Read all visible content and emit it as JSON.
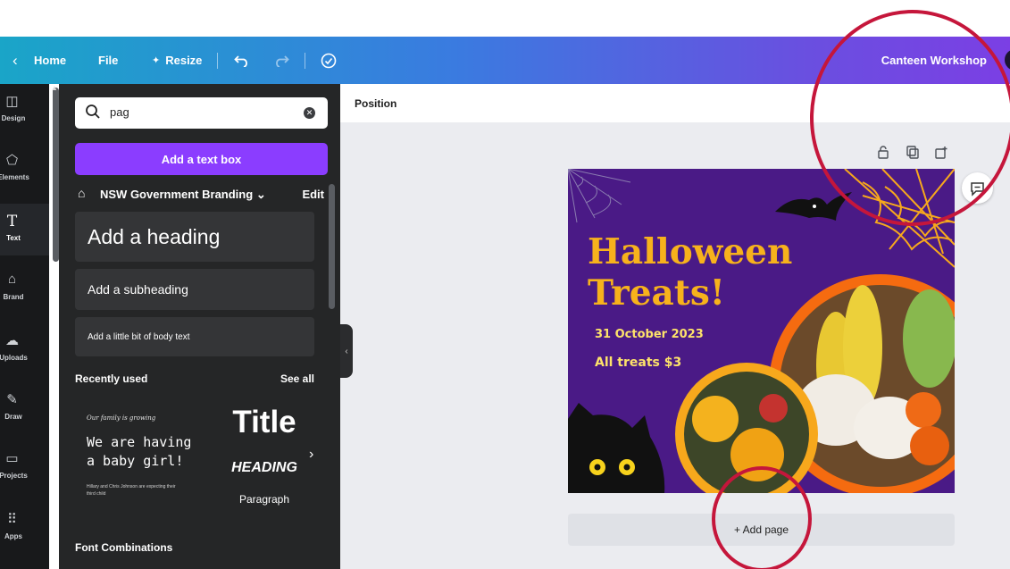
{
  "topbar": {
    "home_label": "Home",
    "file_label": "File",
    "resize_label": "Resize",
    "document_title": "Canteen Workshop",
    "icons": [
      "back-chevron-icon",
      "undo-icon",
      "redo-icon",
      "cloud-sync-icon",
      "sparkle-icon"
    ]
  },
  "rail": {
    "items": [
      {
        "label": "Design",
        "icon": "layout-icon"
      },
      {
        "label": "Elements",
        "icon": "shapes-icon"
      },
      {
        "label": "Text",
        "icon": "text-icon"
      },
      {
        "label": "Brand",
        "icon": "brand-icon"
      },
      {
        "label": "Uploads",
        "icon": "upload-cloud-icon"
      },
      {
        "label": "Draw",
        "icon": "pen-icon"
      },
      {
        "label": "Projects",
        "icon": "folder-icon"
      },
      {
        "label": "Apps",
        "icon": "apps-grid-icon"
      }
    ],
    "active": "Text"
  },
  "panel": {
    "search_value": "pag",
    "add_textbox_label": "Add a text box",
    "brand_kit_label": "NSW Government Branding",
    "brand_edit_label": "Edit",
    "heading_label": "Add a heading",
    "subheading_label": "Add a subheading",
    "body_label": "Add a little bit of body text",
    "recently_used_label": "Recently used",
    "see_all_label": "See all",
    "combo1": {
      "small": "Our family is growing",
      "line1": "We are having",
      "line2": "a baby girl!",
      "tiny": "Hillary and Chris Johnson are expecting their third child"
    },
    "combo2": {
      "title": "Title",
      "heading": "HEADING",
      "paragraph": "Paragraph"
    },
    "font_combinations_label": "Font Combinations"
  },
  "canvas": {
    "position_label": "Position",
    "add_page_label": "+ Add page",
    "design": {
      "title_line1": "Halloween",
      "title_line2": "Treats!",
      "date": "31 October 2023",
      "price": "All treats $3"
    },
    "colors": {
      "background": "#4a1a86",
      "title": "#f7b21c",
      "subtitle": "#fde26a",
      "ring": "#f56b10"
    }
  },
  "colors": {
    "accent": "#8b3dff",
    "annotation": "#c5163b"
  }
}
